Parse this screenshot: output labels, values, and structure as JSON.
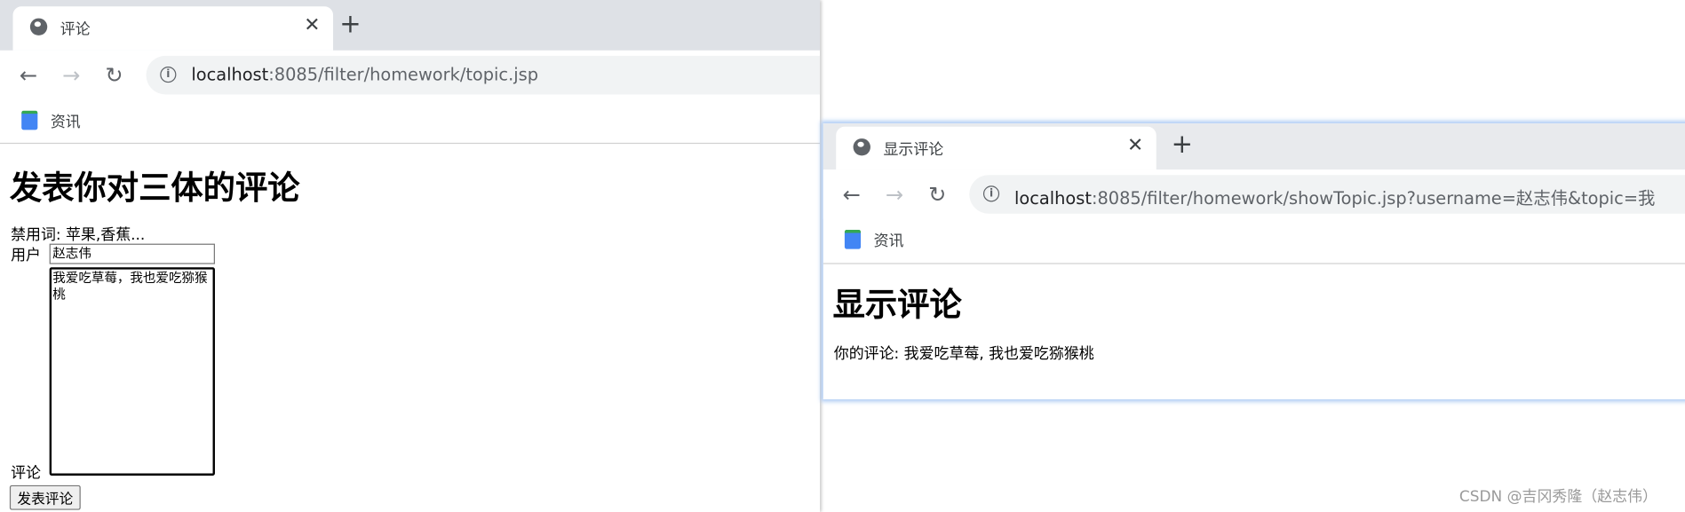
{
  "left_window": {
    "tab_title": "评论",
    "url_host": "localhost",
    "url_rest": ":8085/filter/homework/topic.jsp",
    "bookmark": "资讯",
    "heading": "发表你对三体的评论",
    "banned_words": "禁用词: 苹果,香蕉...",
    "user_label": "用户",
    "user_value": "赵志伟",
    "comment_label": "评论",
    "comment_value": "我爱吃草莓，我也爱吃猕猴桃",
    "submit_label": "发表评论"
  },
  "right_window": {
    "tab_title": "显示评论",
    "url_host": "localhost",
    "url_rest": ":8085/filter/homework/showTopic.jsp?username=赵志伟&topic=我",
    "bookmark": "资讯",
    "heading": "显示评论",
    "comment_text": "你的评论: 我爱吃草莓, 我也爱吃猕猴桃"
  },
  "watermark": "CSDN @吉冈秀隆（赵志伟）"
}
